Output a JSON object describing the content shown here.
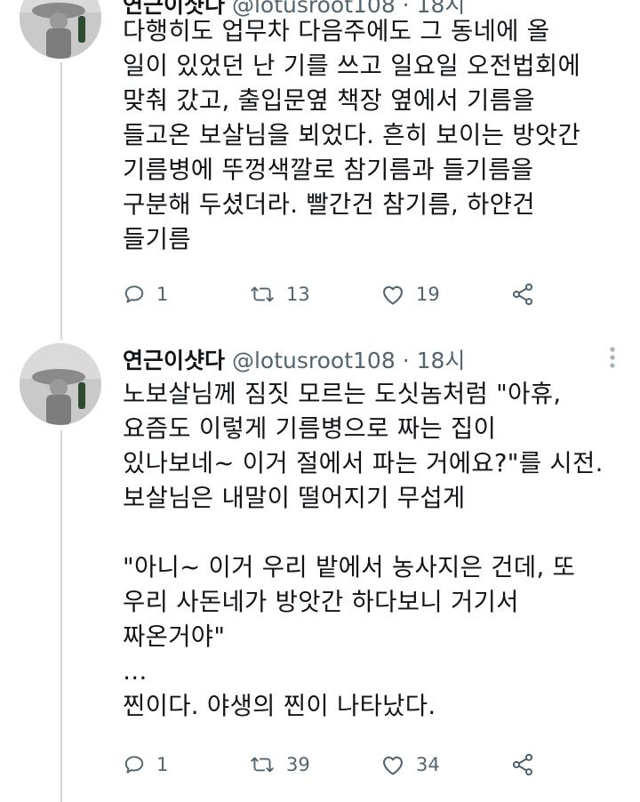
{
  "tweet1": {
    "name_partial": "연근이샷다",
    "handle_partial": "@lotusroot108 · 18시",
    "text": "다행히도 업무차 다음주에도 그 동네에 올\n일이 있었던 난 기를 쓰고 일요일 오전법회에\n맞춰 갔고, 출입문옆 책장 옆에서 기름을\n들고온 보살님을 뵈었다. 흔히 보이는 방앗간\n기름병에 뚜껑색깔로 참기름과 들기름을\n구분해 두셨더라. 빨간건 참기름, 하얀건\n들기름",
    "replies": "1",
    "retweets": "13",
    "likes": "19"
  },
  "tweet2": {
    "name": "연근이샷다",
    "handle": "@lotusroot108",
    "time": "· 18시",
    "text": "노보살님께 짐짓 모르는 도싯놈처럼 \"아휴,\n요즘도 이렇게 기름병으로 짜는 집이\n있나보네~ 이거 절에서 파는 거에요?\"를 시전.\n보살님은 내말이 떨어지기 무섭게\n\n\"아니~ 이거 우리 밭에서 농사지은 건데, 또\n우리 사돈네가 방앗간 하다보니 거기서\n짜온거야\"\n…\n찐이다. 야생의 찐이 나타났다.",
    "replies": "1",
    "retweets": "39",
    "likes": "34"
  },
  "icons": {
    "reply": "reply-icon",
    "retweet": "retweet-icon",
    "like": "heart-icon",
    "share": "share-icon",
    "more": "more-icon"
  },
  "colors": {
    "meta": "#536471",
    "text": "#0f1419",
    "thread": "#cfd9de"
  }
}
